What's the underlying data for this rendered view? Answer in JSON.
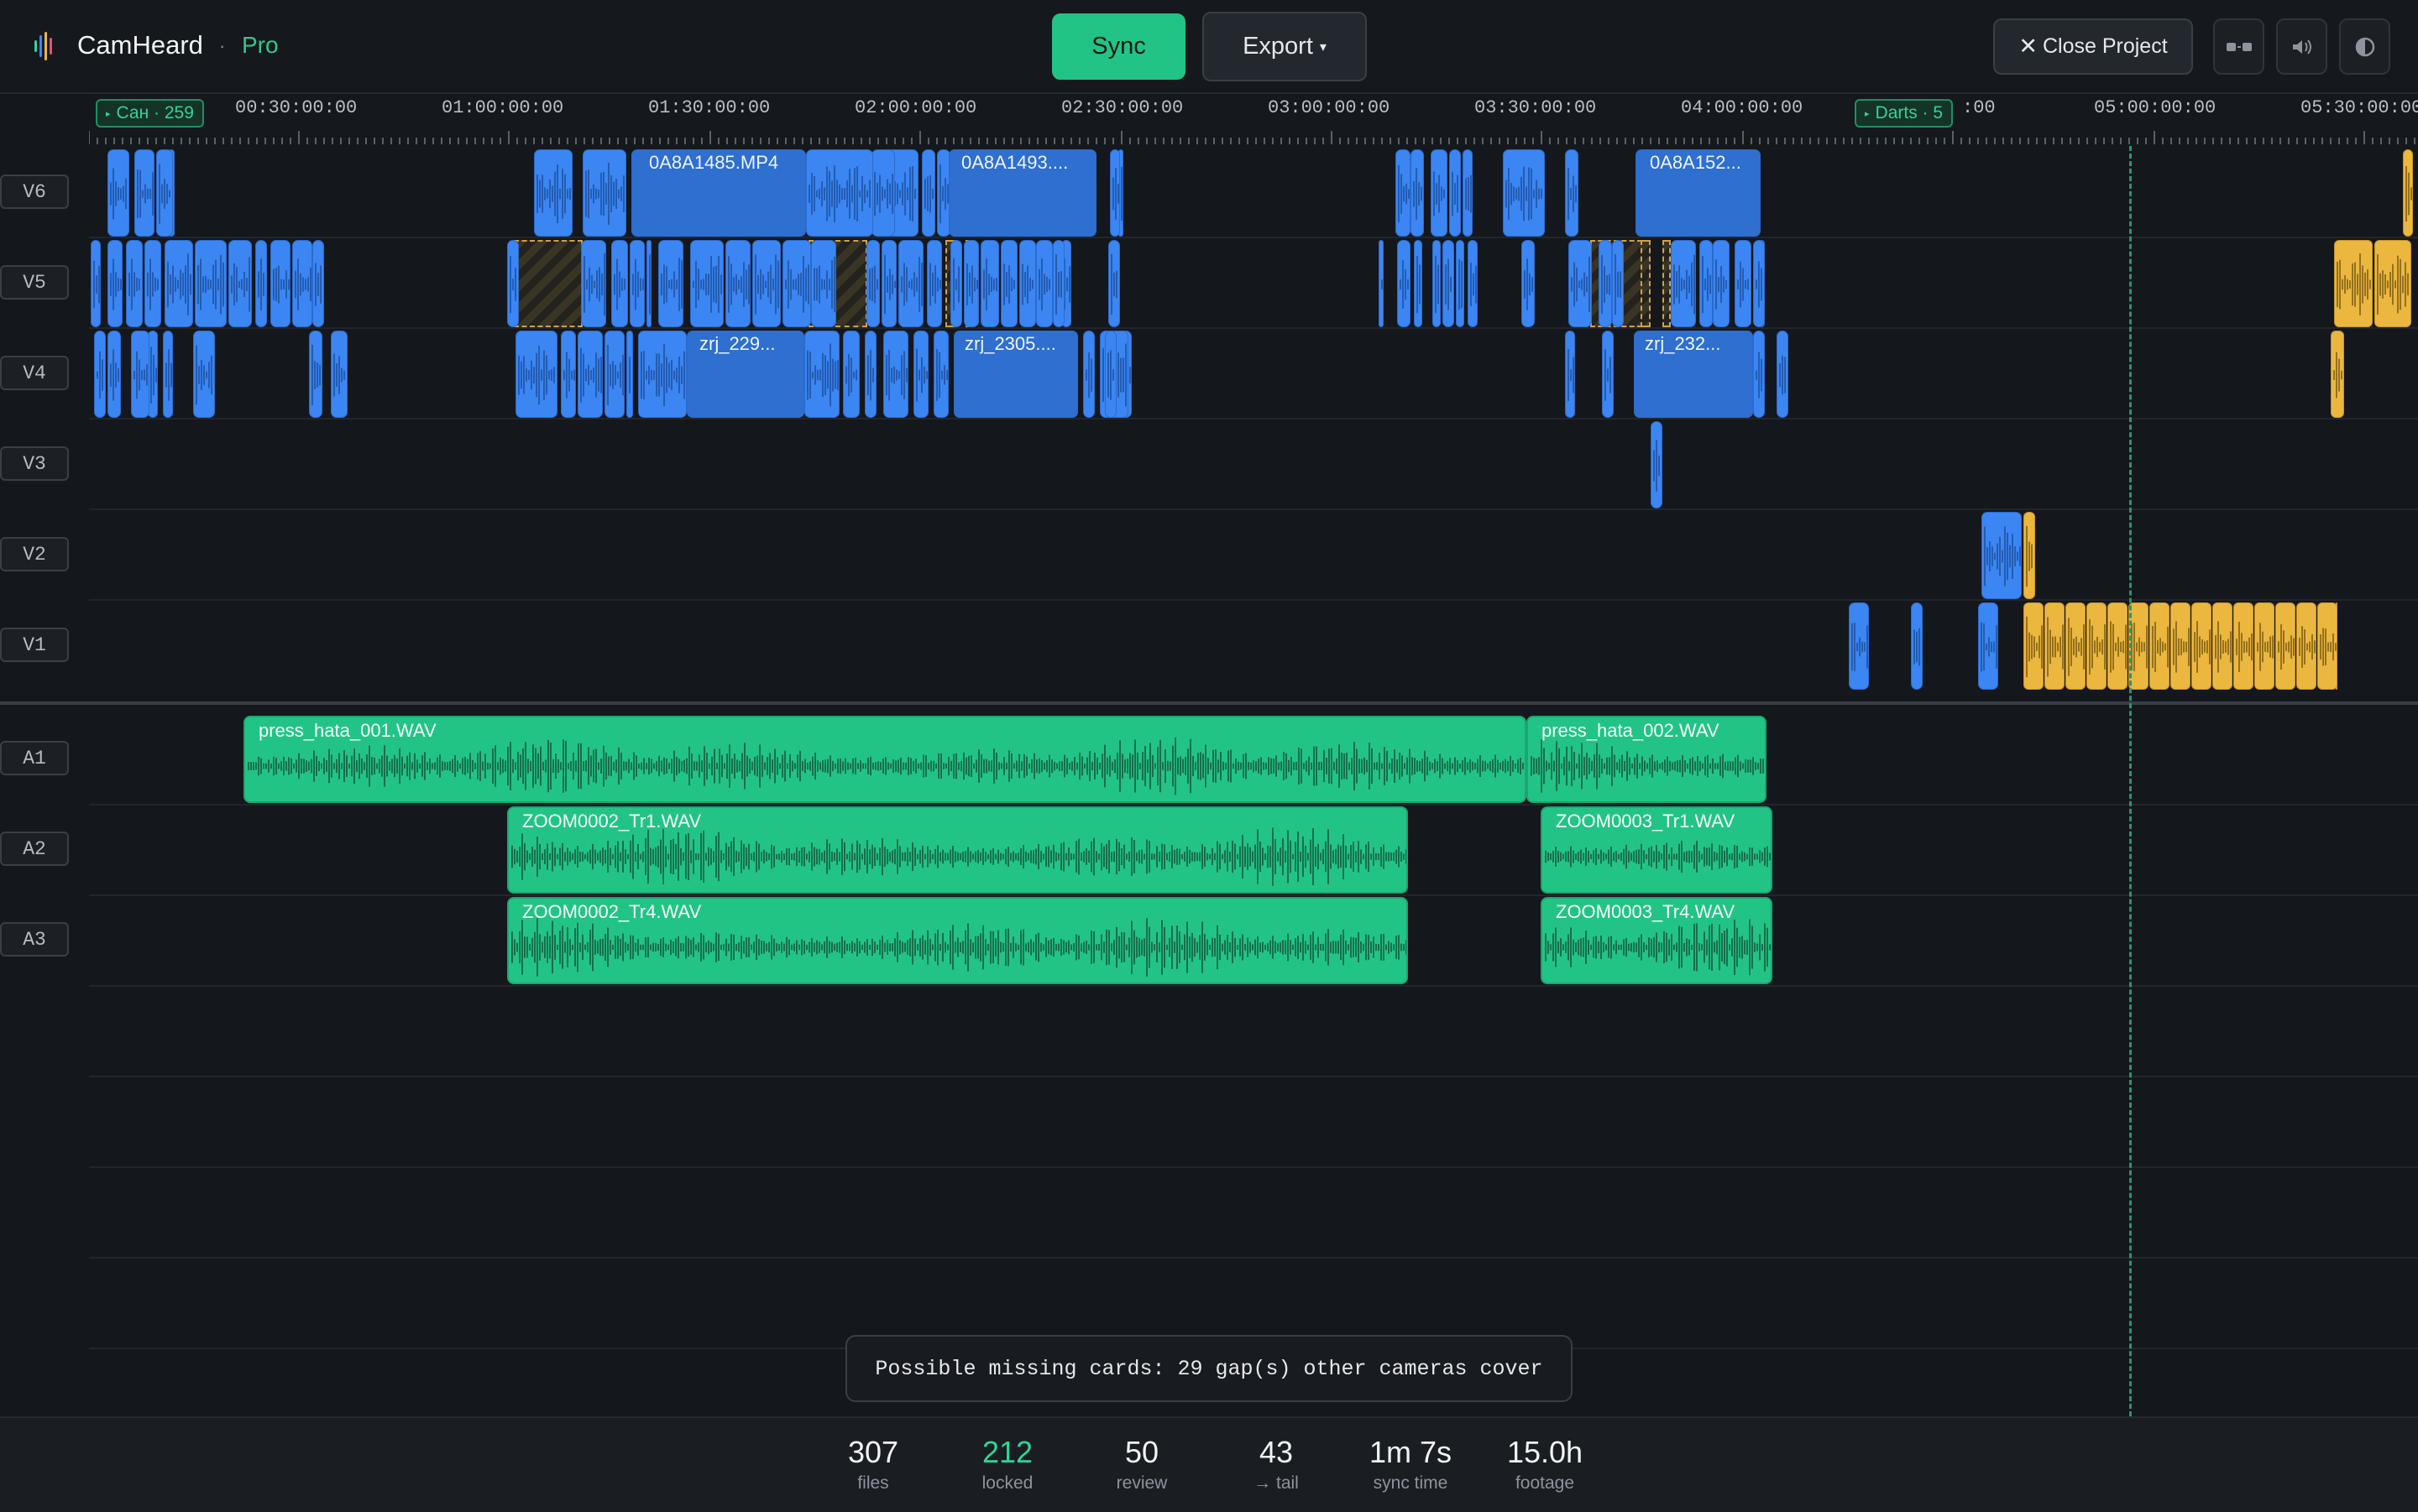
{
  "app": {
    "name": "CamHeard",
    "separator": "·",
    "plan": "Pro"
  },
  "toolbar": {
    "sync_label": "Sync",
    "export_label": "Export",
    "export_caret": "▾",
    "close_label": "Close Project",
    "close_icon": "✕"
  },
  "ruler": {
    "ticks": [
      "00:30:00:00",
      "01:00:00:00",
      "01:30:00:00",
      "02:00:00:00",
      "02:30:00:00",
      "03:00:00:00",
      "03:30:00:00",
      "04:00:00:00",
      ":00",
      "05:00:00:00",
      "05:30:00:00"
    ],
    "markers": [
      {
        "label": "Сан · 259"
      },
      {
        "label": "Darts · 5"
      }
    ]
  },
  "tracks": {
    "video": [
      "V6",
      "V5",
      "V4",
      "V3",
      "V2",
      "V1"
    ],
    "audio": [
      "A1",
      "A2",
      "A3"
    ]
  },
  "clips": {
    "v6_a": "0A8A1485.MP4",
    "v6_b": "0A8A1493....",
    "v6_c": "0A8A152...",
    "v4_a": "zrj_229...",
    "v4_b": "zrj_2305....",
    "v4_c": "zrj_232...",
    "a1_a": "press_hata_001.WAV",
    "a1_b": "press_hata_002.WAV",
    "a2_a": "ZOOM0002_Tr1.WAV",
    "a2_b": "ZOOM0003_Tr1.WAV",
    "a3_a": "ZOOM0002_Tr4.WAV",
    "a3_b": "ZOOM0003_Tr4.WAV"
  },
  "toast": "Possible missing cards: 29 gap(s) other cameras cover",
  "stats": [
    {
      "value": "307",
      "label": "files"
    },
    {
      "value": "212",
      "label": "locked"
    },
    {
      "value": "50",
      "label": "review"
    },
    {
      "value": "43",
      "label": "→ tail"
    },
    {
      "value": "1m 7s",
      "label": "sync time"
    },
    {
      "value": "15.0h",
      "label": "footage"
    }
  ],
  "colors": {
    "accent": "#22c485",
    "video_clip": "#3b86f2",
    "tail_clip": "#ebb73f",
    "background": "#14171c"
  },
  "icons": [
    "logo-icon",
    "split-icon",
    "volume-icon",
    "contrast-icon",
    "close-icon"
  ]
}
